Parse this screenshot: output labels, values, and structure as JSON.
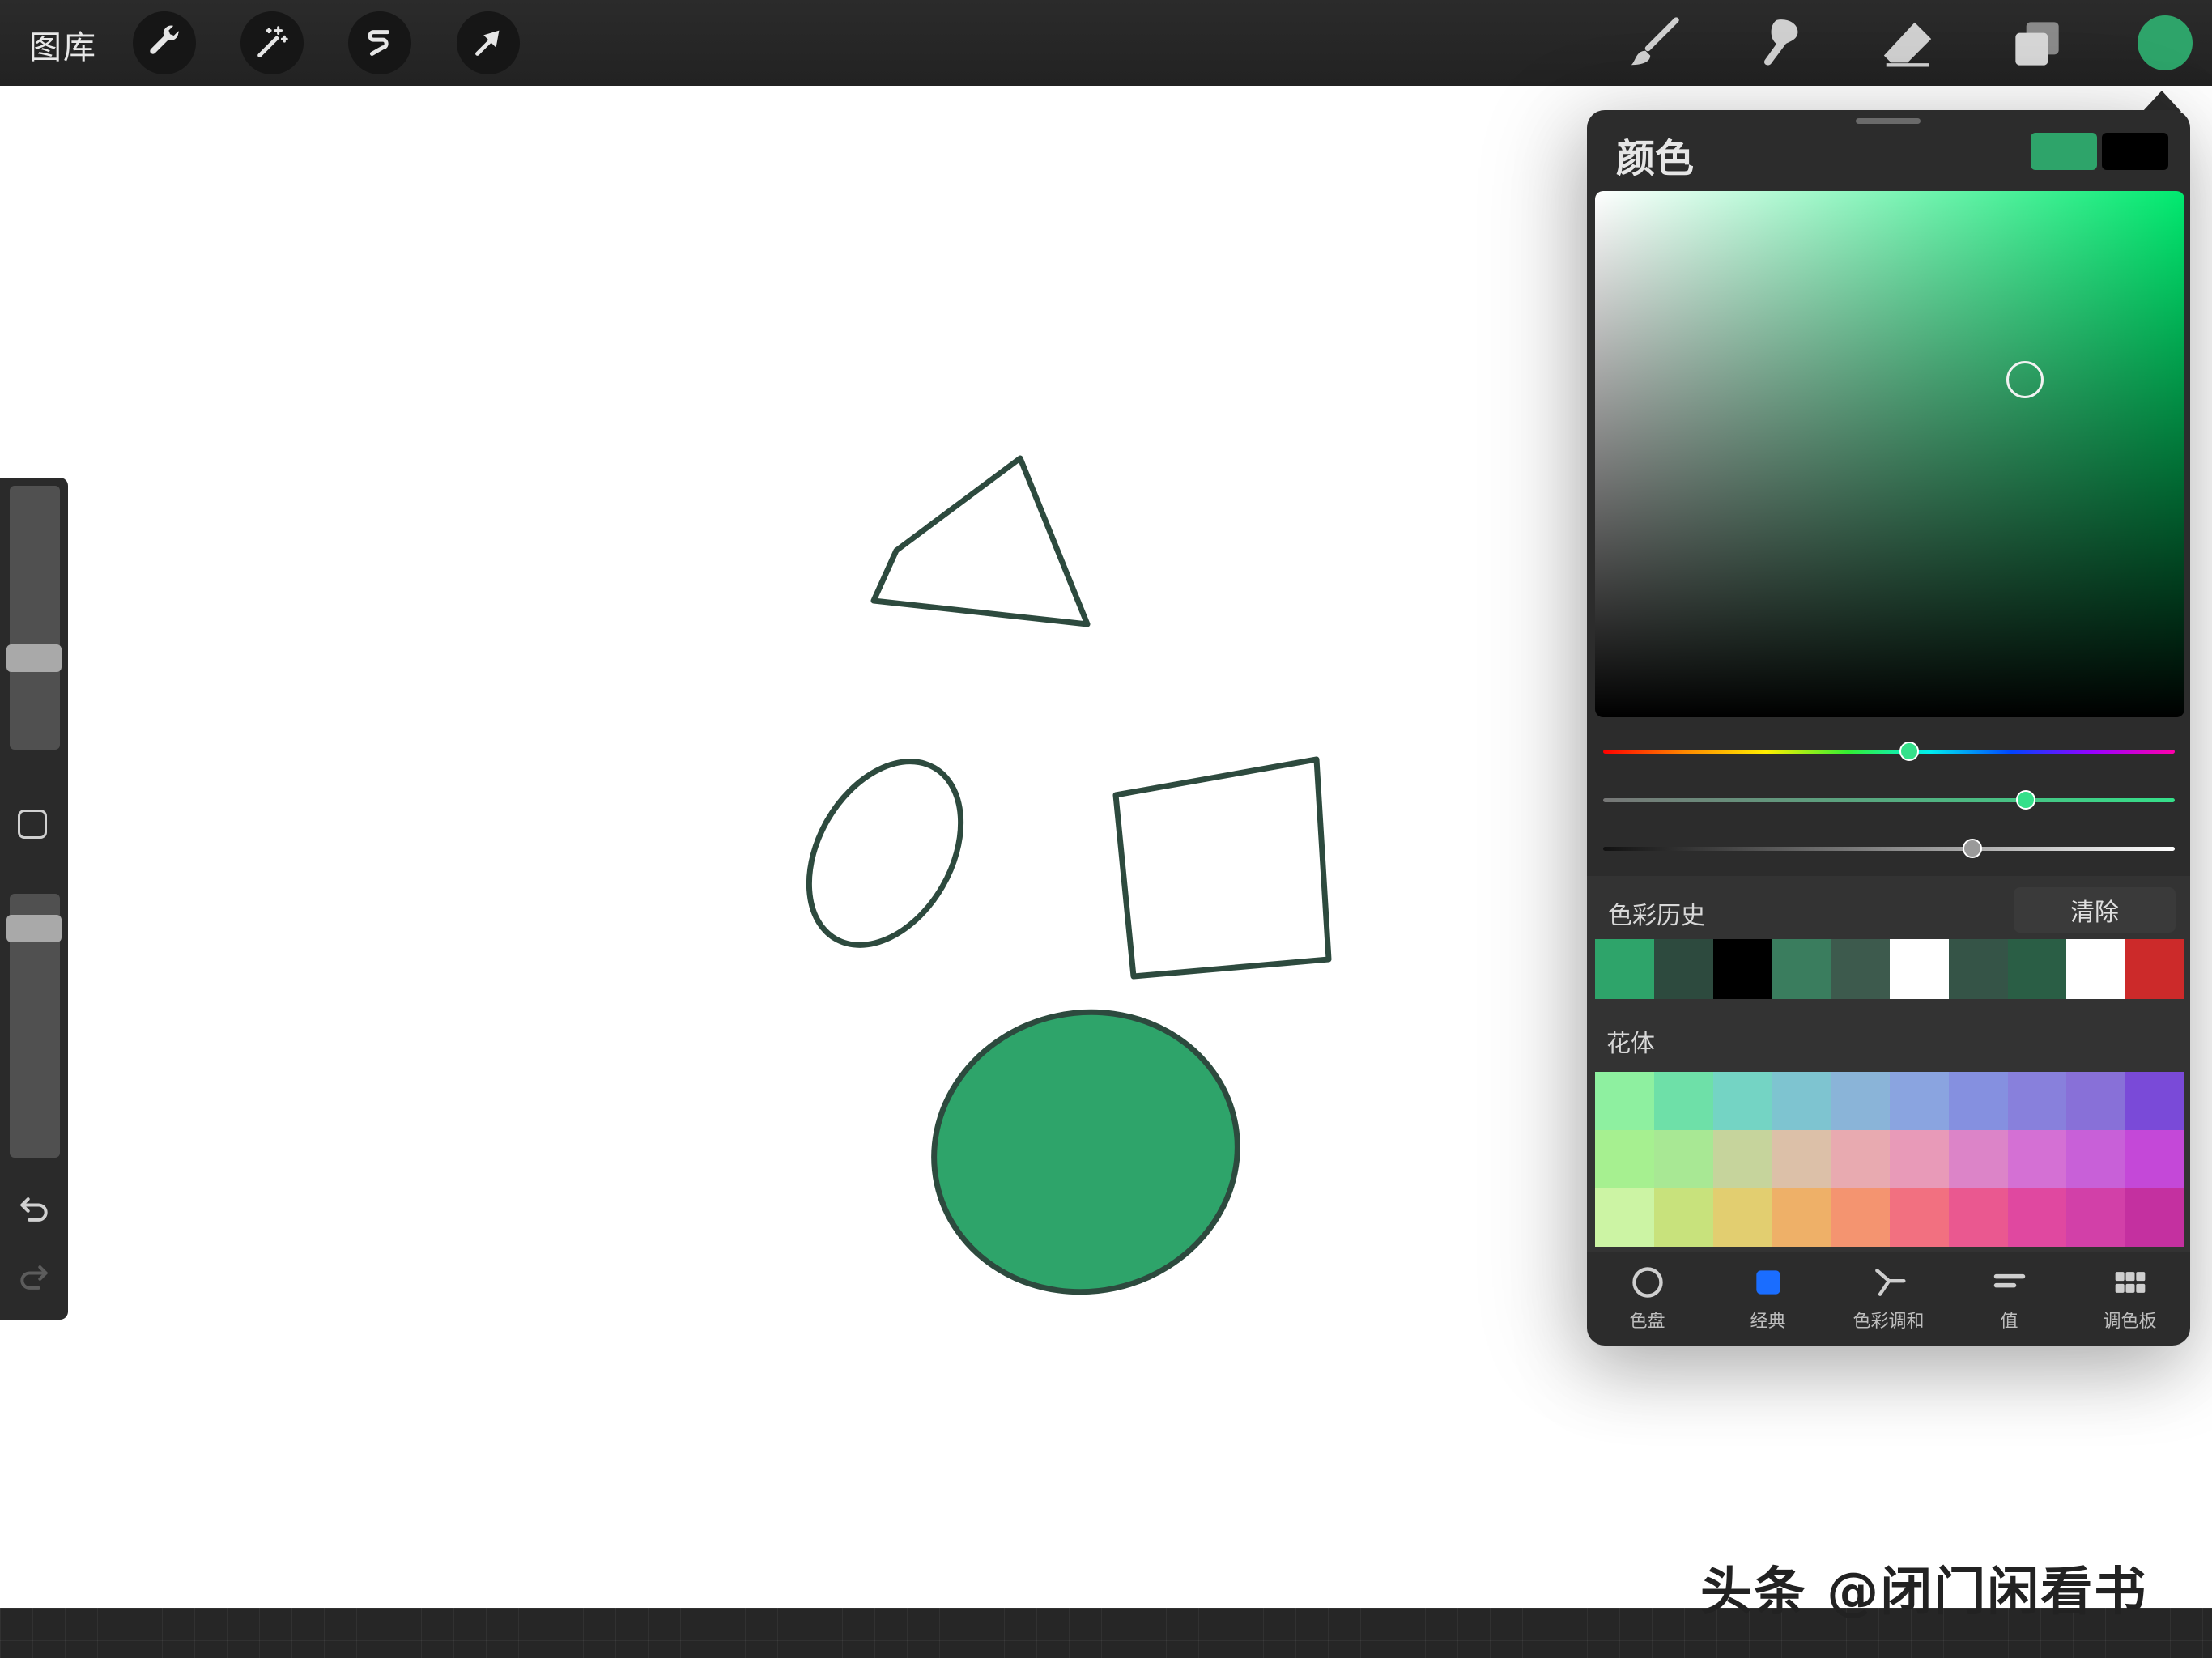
{
  "topbar": {
    "gallery_label": "图库",
    "tools_left": [
      "wrench-icon",
      "magic-wand-icon",
      "selection-icon",
      "transform-arrow-icon"
    ],
    "tools_right": [
      "brush-icon",
      "smudge-icon",
      "eraser-icon",
      "layers-icon"
    ],
    "current_color": "#2ea46a"
  },
  "canvas": {
    "shapes": [
      "triangle-outline",
      "ellipse-outline",
      "quadrilateral-outline",
      "filled-green-ellipse"
    ],
    "stroke_color": "#2d4a3e",
    "fill_color": "#2ea46a"
  },
  "color_panel": {
    "title": "颜色",
    "primary_color": "#2ea46a",
    "secondary_color": "#000000",
    "history_label": "色彩历史",
    "clear_label": "清除",
    "history_colors": [
      "#2ea46a",
      "#2d4a3e",
      "#000000",
      "#3a7d5e",
      "#3d5a4d",
      "#ffffff",
      "#355447",
      "#2a5e45",
      "#ffffff",
      "#cc2a2a"
    ],
    "palette_label": "花体",
    "palette_colors": [
      "#8ef0a0",
      "#6ee0a8",
      "#74d4c4",
      "#7ec4d0",
      "#8ab4d8",
      "#8aa4e0",
      "#8590e0",
      "#8880dc",
      "#8870d8",
      "#7a4ad8",
      "#a6f090",
      "#a8e894",
      "#c6d49c",
      "#dcc0a8",
      "#e8aab0",
      "#e89ab8",
      "#dc84c8",
      "#d470d4",
      "#c860d8",
      "#c448d8",
      "#ccf4a4",
      "#c8e27c",
      "#e2ce70",
      "#eeb068",
      "#f49470",
      "#f27080",
      "#ea5890",
      "#e048a0",
      "#d240a8",
      "#c430a0"
    ],
    "tabs": [
      {
        "label": "色盘",
        "icon": "disc-icon"
      },
      {
        "label": "经典",
        "icon": "classic-square-icon"
      },
      {
        "label": "色彩调和",
        "icon": "harmony-icon"
      },
      {
        "label": "值",
        "icon": "value-sliders-icon"
      },
      {
        "label": "调色板",
        "icon": "palette-grid-icon"
      }
    ]
  },
  "watermark": "头条 @闭门闲看书"
}
